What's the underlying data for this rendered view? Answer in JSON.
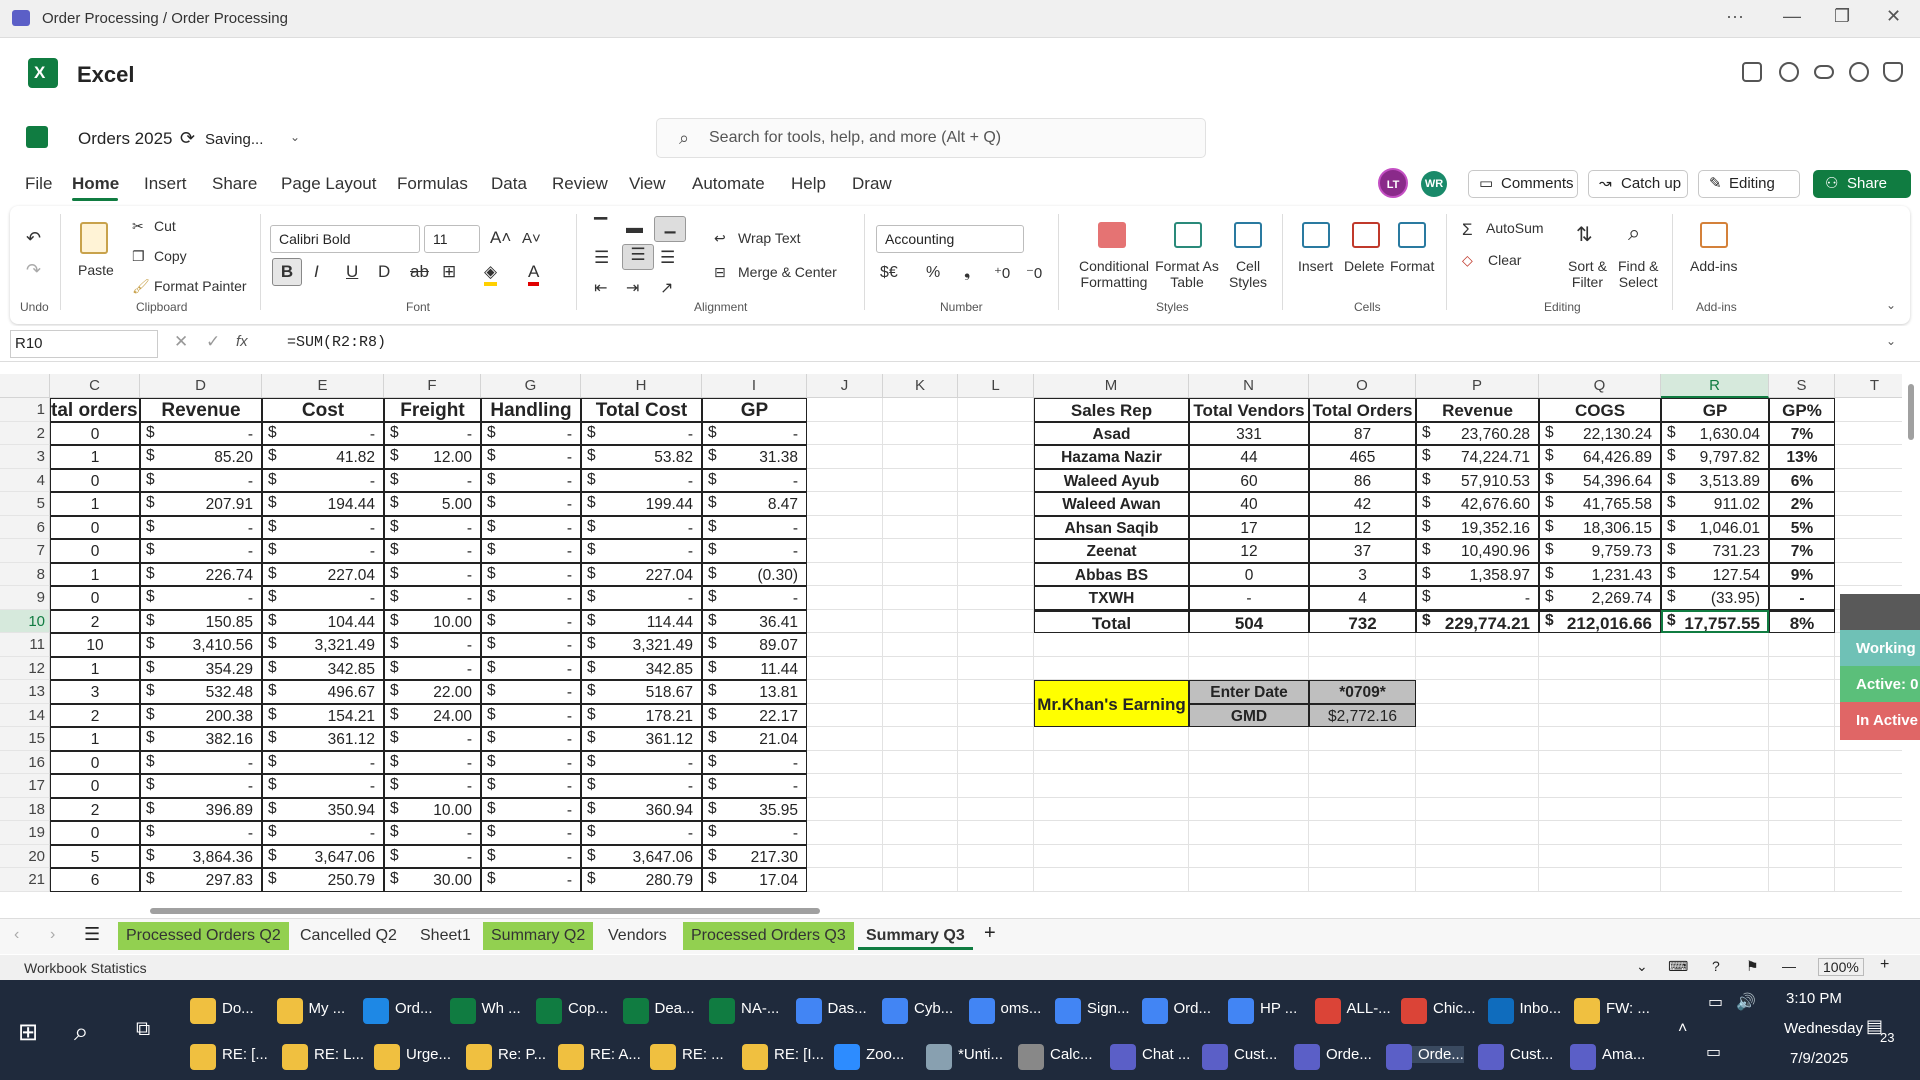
{
  "window": {
    "title": "Order Processing / Order Processing"
  },
  "app": {
    "name": "Excel"
  },
  "doc": {
    "name": "Orders 2025",
    "status": "Saving..."
  },
  "search": {
    "placeholder": "Search for tools, help, and more (Alt + Q)"
  },
  "menu": [
    "File",
    "Home",
    "Insert",
    "Share",
    "Page Layout",
    "Formulas",
    "Data",
    "Review",
    "View",
    "Automate",
    "Help",
    "Draw"
  ],
  "avatars": [
    "LT",
    "WR"
  ],
  "header_buttons": {
    "comments": "Comments",
    "catchup": "Catch up",
    "editing": "Editing",
    "share": "Share"
  },
  "ribbon": {
    "undo_group": "Undo",
    "clipboard": {
      "paste": "Paste",
      "cut": "Cut",
      "copy": "Copy",
      "format_painter": "Format Painter",
      "group": "Clipboard"
    },
    "font": {
      "name": "Calibri Bold",
      "size": "11",
      "group": "Font"
    },
    "alignment": {
      "wrap": "Wrap Text",
      "merge": "Merge & Center",
      "group": "Alignment"
    },
    "number": {
      "format": "Accounting",
      "group": "Number"
    },
    "styles": {
      "cond": "Conditional",
      "cond2": "Formatting",
      "fat": "Format As",
      "fat2": "Table",
      "cs": "Cell",
      "cs2": "Styles",
      "group": "Styles"
    },
    "cells": {
      "insert": "Insert",
      "delete": "Delete",
      "format": "Format",
      "group": "Cells"
    },
    "editing": {
      "autosum": "AutoSum",
      "clear": "Clear",
      "sort": "Sort &",
      "sort2": "Filter",
      "find": "Find &",
      "find2": "Select",
      "group": "Editing"
    },
    "addins": {
      "label": "Add-ins",
      "group": "Add-ins"
    }
  },
  "formula_bar": {
    "name_box": "R10",
    "formula": "=SUM(R2:R8)"
  },
  "columns": [
    "C",
    "D",
    "E",
    "F",
    "G",
    "H",
    "I",
    "J",
    "K",
    "L",
    "M",
    "N",
    "O",
    "P",
    "Q",
    "R",
    "S",
    "T"
  ],
  "rows": [
    "1",
    "2",
    "3",
    "4",
    "5",
    "6",
    "7",
    "8",
    "9",
    "10",
    "11",
    "12",
    "13",
    "14",
    "15",
    "16",
    "17",
    "18",
    "19",
    "20",
    "21"
  ],
  "left_table": {
    "headers": [
      "tal orders",
      "Revenue",
      "Cost",
      "Freight",
      "Handling",
      "Total Cost",
      "GP"
    ],
    "rows": [
      [
        "0",
        "-",
        "-",
        "-",
        "-",
        "-",
        "-"
      ],
      [
        "1",
        "85.20",
        "41.82",
        "12.00",
        "-",
        "53.82",
        "31.38"
      ],
      [
        "0",
        "-",
        "-",
        "-",
        "-",
        "-",
        "-"
      ],
      [
        "1",
        "207.91",
        "194.44",
        "5.00",
        "-",
        "199.44",
        "8.47"
      ],
      [
        "0",
        "-",
        "-",
        "-",
        "-",
        "-",
        "-"
      ],
      [
        "0",
        "-",
        "-",
        "-",
        "-",
        "-",
        "-"
      ],
      [
        "1",
        "226.74",
        "227.04",
        "-",
        "-",
        "227.04",
        "(0.30)"
      ],
      [
        "0",
        "-",
        "-",
        "-",
        "-",
        "-",
        "-"
      ],
      [
        "2",
        "150.85",
        "104.44",
        "10.00",
        "-",
        "114.44",
        "36.41"
      ],
      [
        "10",
        "3,410.56",
        "3,321.49",
        "-",
        "-",
        "3,321.49",
        "89.07"
      ],
      [
        "1",
        "354.29",
        "342.85",
        "-",
        "-",
        "342.85",
        "11.44"
      ],
      [
        "3",
        "532.48",
        "496.67",
        "22.00",
        "-",
        "518.67",
        "13.81"
      ],
      [
        "2",
        "200.38",
        "154.21",
        "24.00",
        "-",
        "178.21",
        "22.17"
      ],
      [
        "1",
        "382.16",
        "361.12",
        "-",
        "-",
        "361.12",
        "21.04"
      ],
      [
        "0",
        "-",
        "-",
        "-",
        "-",
        "-",
        "-"
      ],
      [
        "0",
        "-",
        "-",
        "-",
        "-",
        "-",
        "-"
      ],
      [
        "2",
        "396.89",
        "350.94",
        "10.00",
        "-",
        "360.94",
        "35.95"
      ],
      [
        "0",
        "-",
        "-",
        "-",
        "-",
        "-",
        "-"
      ],
      [
        "5",
        "3,864.36",
        "3,647.06",
        "-",
        "-",
        "3,647.06",
        "217.30"
      ],
      [
        "6",
        "297.83",
        "250.79",
        "30.00",
        "-",
        "280.79",
        "17.04"
      ]
    ]
  },
  "summary_table": {
    "headers": [
      "Sales Rep",
      "Total Vendors",
      "Total Orders",
      "Revenue",
      "COGS",
      "GP",
      "GP%"
    ],
    "rows": [
      [
        "Asad",
        "331",
        "87",
        "23,760.28",
        "22,130.24",
        "1,630.04",
        "7%"
      ],
      [
        "Hazama Nazir",
        "44",
        "465",
        "74,224.71",
        "64,426.89",
        "9,797.82",
        "13%"
      ],
      [
        "Waleed Ayub",
        "60",
        "86",
        "57,910.53",
        "54,396.64",
        "3,513.89",
        "6%"
      ],
      [
        "Waleed Awan",
        "40",
        "42",
        "42,676.60",
        "41,765.58",
        "911.02",
        "2%"
      ],
      [
        "Ahsan Saqib",
        "17",
        "12",
        "19,352.16",
        "18,306.15",
        "1,046.01",
        "5%"
      ],
      [
        "Zeenat",
        "12",
        "37",
        "10,490.96",
        "9,759.73",
        "731.23",
        "7%"
      ],
      [
        "Abbas BS",
        "0",
        "3",
        "1,358.97",
        "1,231.43",
        "127.54",
        "9%"
      ],
      [
        "TXWH",
        "-",
        "4",
        "-",
        "2,269.74",
        "(33.95)",
        "-"
      ]
    ],
    "total": [
      "Total",
      "504",
      "732",
      "229,774.21",
      "212,016.66",
      "17,757.55",
      "8%"
    ]
  },
  "earning": {
    "label": "Mr.Khan's Earning",
    "date_label": "Enter Date",
    "date_value": "*0709*",
    "gmd_label": "GMD",
    "gmd_value": "$2,772.16"
  },
  "side_panel": {
    "working": "Working",
    "active": "Active: 0",
    "inactive": "In Active"
  },
  "sheets": [
    "Processed Orders Q2",
    "Cancelled Q2",
    "Sheet1",
    "Summary Q2",
    "Vendors",
    "Processed Orders Q3",
    "Summary Q3"
  ],
  "status": {
    "left": "Workbook Statistics",
    "zoom": "100%"
  },
  "taskbar": {
    "row1": [
      "Do...",
      "My ...",
      "Ord...",
      "Wh ...",
      "Cop...",
      "Dea...",
      "NA-...",
      "Das...",
      "Cyb...",
      "oms...",
      "Sign...",
      "Ord...",
      "HP ...",
      "ALL-...",
      "Chic...",
      "Inbo...",
      "FW: ..."
    ],
    "row2": [
      "RE: [...",
      "RE: L...",
      "Urge...",
      "Re: P...",
      "RE: A...",
      "RE: ...",
      "RE: [I...",
      "Zoo...",
      "*Unti...",
      "Calc...",
      "Chat ...",
      "Cust...",
      "Orde...",
      "Orde...",
      "Cust...",
      "Ama..."
    ],
    "time": "3:10 PM",
    "day": "Wednesday",
    "date": "7/9/2025",
    "notif": "23"
  },
  "colors": {
    "excel_green": "#107c41",
    "sheet_tab_green": "#92d050",
    "yellow": "#ffff00",
    "working": "#6fc1b6",
    "active": "#5bbf7a",
    "inactive": "#e06666"
  }
}
